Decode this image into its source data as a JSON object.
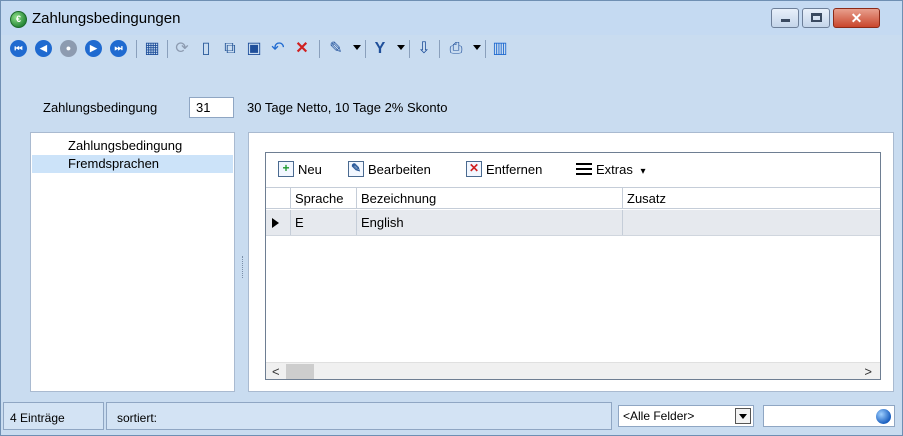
{
  "window": {
    "title": "Zahlungsbedingungen",
    "app_icon": "currency-exchange-icon",
    "controls": [
      "minimize-icon",
      "maximize-icon",
      "close-icon"
    ]
  },
  "toolbar": {
    "navigation": [
      "first-record-icon",
      "previous-record-icon",
      "center-record-icon",
      "next-record-icon",
      "last-record-icon"
    ],
    "tools": [
      "calendar-table-icon",
      "refresh-icon",
      "new-document-icon",
      "copy-icon",
      "save-icon",
      "undo-icon",
      "delete-icon",
      "tools-icon",
      "filter-icon",
      "export-icon",
      "print-icon",
      "book-icon"
    ]
  },
  "record": {
    "label": "Zahlungsbedingung",
    "number": "31",
    "description": "30 Tage Netto, 10 Tage 2% Skonto"
  },
  "sidebar": {
    "items": [
      {
        "label": "Zahlungsbedingung",
        "selected": false
      },
      {
        "label": "Fremdsprachen",
        "selected": true
      }
    ]
  },
  "grid": {
    "toolbar": {
      "new_label": "Neu",
      "edit_label": "Bearbeiten",
      "remove_label": "Entfernen",
      "extras_label": "Extras",
      "extras_arrow": "▾"
    },
    "columns": [
      "Sprache",
      "Bezeichnung",
      "Zusatz"
    ],
    "rows": [
      {
        "sprache": "E",
        "bezeichnung": "English",
        "zusatz": ""
      }
    ]
  },
  "status": {
    "count": "4 Einträge",
    "sort_label": "sortiert:",
    "field_filter": "<Alle Felder>",
    "search_value": ""
  },
  "colors": {
    "chrome": "#c9dcf0",
    "selection": "#cce3f9",
    "nav_blue": "#1f6ad0",
    "close_red": "#c9462c"
  }
}
